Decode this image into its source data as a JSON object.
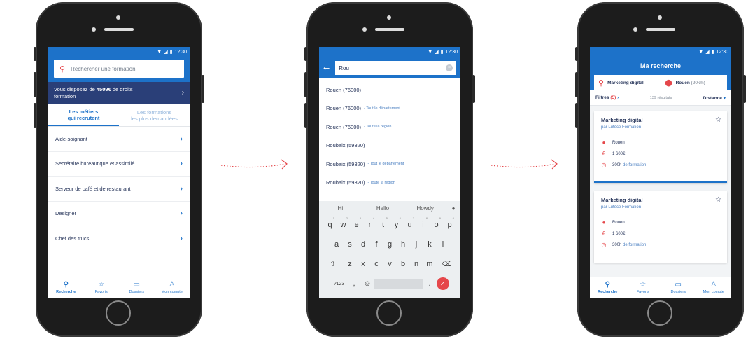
{
  "status": {
    "time": "12:30"
  },
  "phone1": {
    "search_placeholder": "Rechercher une formation",
    "banner_prefix": "Vous disposez de ",
    "banner_amount": "4509€",
    "banner_suffix": " de droits",
    "banner_line2": "formation",
    "tabs": [
      {
        "line1": "Les métiers",
        "line2": "qui recrutent"
      },
      {
        "line1": "Les formations",
        "line2": "les plus demandées"
      }
    ],
    "list": [
      "Aide-soignant",
      "Secrétaire bureautique et assimilé",
      "Serveur de café et de restaurant",
      "Designer",
      "Chef des trucs"
    ]
  },
  "navbar": {
    "items": [
      "Recherche",
      "Favoris",
      "Dossiers",
      "Mon compte"
    ]
  },
  "phone2": {
    "query": "Rou",
    "suggestions": [
      {
        "city": "Rouen (76000)",
        "scope": ""
      },
      {
        "city": "Rouen (76000)",
        "scope": "- Tout le département"
      },
      {
        "city": "Rouen (76000)",
        "scope": "- Toute la région"
      },
      {
        "city": "Roubaix (59320)",
        "scope": ""
      },
      {
        "city": "Roubaix (59320)",
        "scope": "- Tout le département"
      },
      {
        "city": "Roubaix (59320)",
        "scope": "- Toute la région"
      }
    ],
    "keyboard": {
      "suggestions": [
        "Hi",
        "Howdy",
        "Hello"
      ],
      "row1": [
        "q",
        "w",
        "e",
        "r",
        "t",
        "y",
        "u",
        "i",
        "o",
        "p"
      ],
      "row1_nums": [
        "1",
        "2",
        "3",
        "4",
        "5",
        "6",
        "7",
        "8",
        "9",
        "0"
      ],
      "row2": [
        "a",
        "s",
        "d",
        "f",
        "g",
        "h",
        "j",
        "k",
        "l"
      ],
      "row3": [
        "z",
        "x",
        "c",
        "v",
        "b",
        "n",
        "m"
      ],
      "symbols": "?123",
      "comma": ",",
      "period": "."
    }
  },
  "phone3": {
    "title": "Ma recherche",
    "query": "Marketing digital",
    "city": "Rouen",
    "radius": "(20km)",
    "filters_label": "Filtres",
    "filters_count": "(5)",
    "results": "139 résultats",
    "sort": "Distance",
    "cards": [
      {
        "title": "Marketing digital",
        "provider": "par Lutèce Formation",
        "city": "Rouen",
        "price": "1 600€",
        "hours": "300h",
        "hours_suffix": " de formation"
      },
      {
        "title": "Marketing digital",
        "provider": "par Lutèce Formation",
        "city": "Rouen",
        "price": "1 600€",
        "hours": "300h",
        "hours_suffix": " de formation"
      }
    ]
  },
  "colors": {
    "brand_blue": "#1d72c9",
    "banner_navy": "#2a3f78",
    "accent_red": "#e5474b"
  }
}
